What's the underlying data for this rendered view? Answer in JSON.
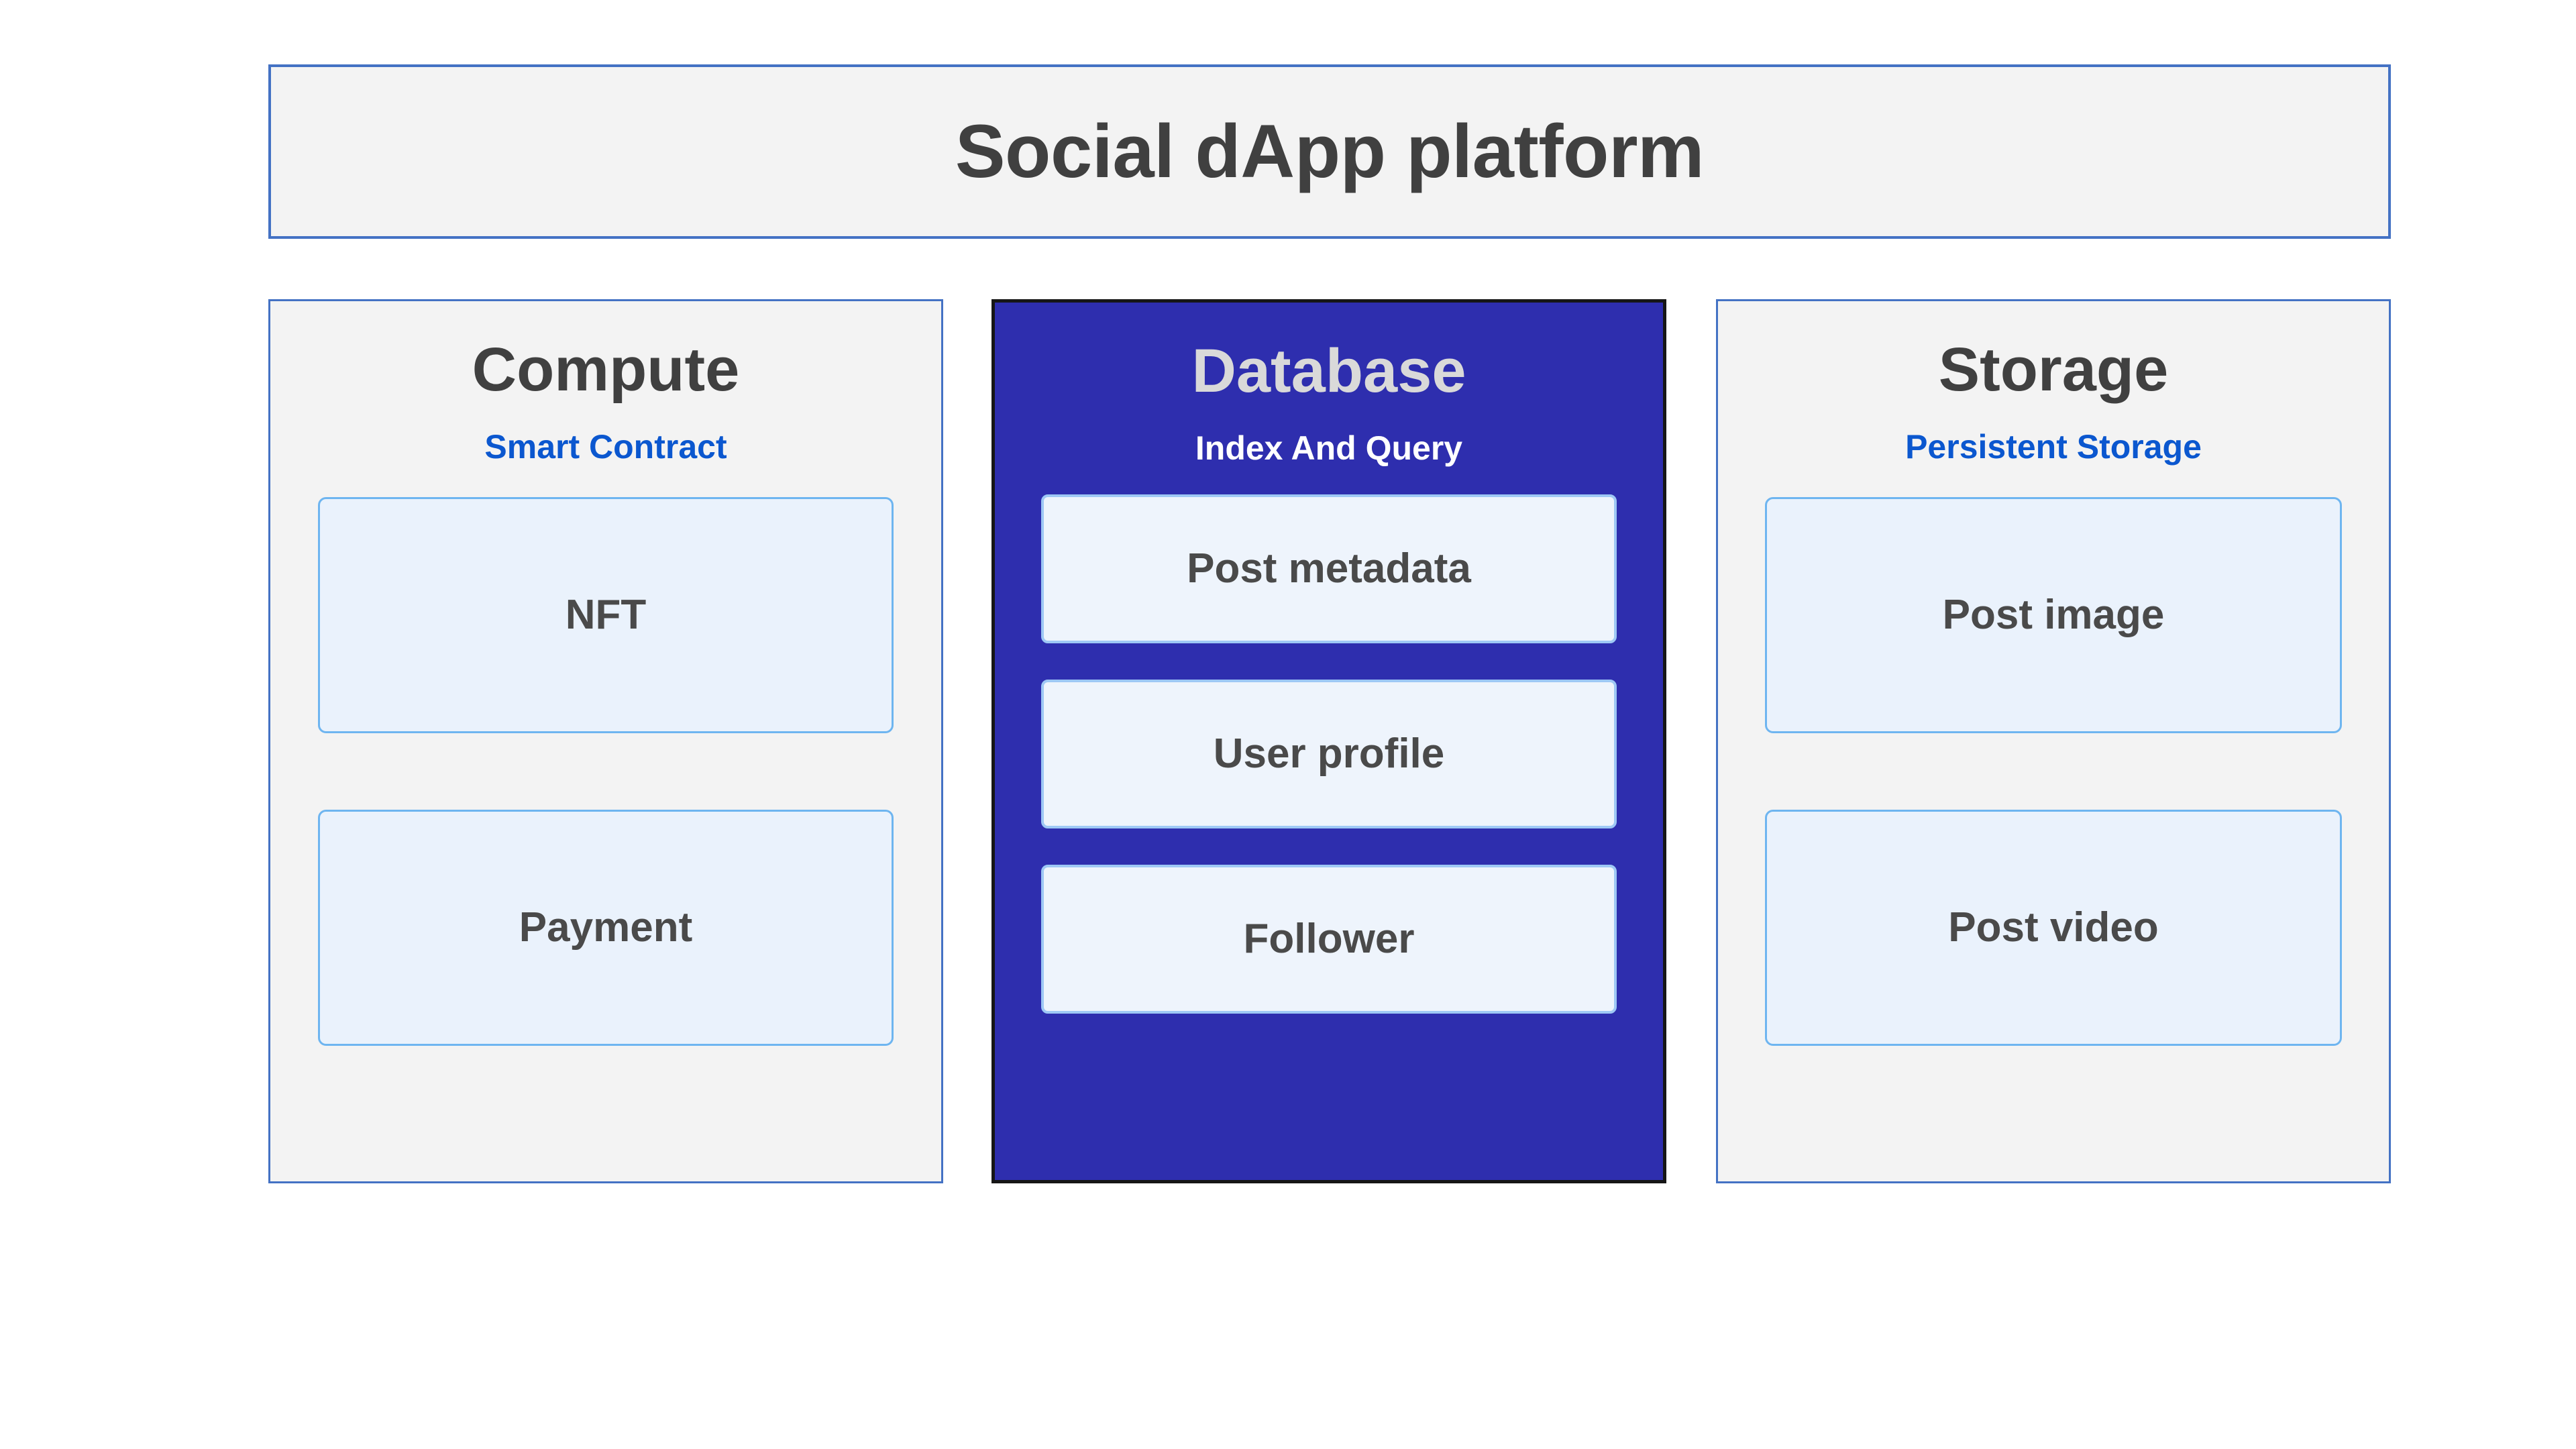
{
  "banner": {
    "title": "Social dApp platform"
  },
  "colors": {
    "banner_fill": "#f3f3f3",
    "banner_border": "#4472c4",
    "column_fill": "#f3f3f3",
    "column_border": "#4472c4",
    "highlight_fill": "#2e2eae",
    "highlight_border": "#161616",
    "card_fill": "#eaf2fc",
    "card_border": "#6eb5f0",
    "title_text": "#404040",
    "subtitle_text": "#0b57cf",
    "highlight_title_text": "#d9d9d9",
    "highlight_subtitle_text": "#ffffff",
    "card_text": "#4a4a4a"
  },
  "columns": [
    {
      "id": "compute",
      "title": "Compute",
      "subtitle": "Smart Contract",
      "highlighted": false,
      "cards": [
        {
          "label": "NFT"
        },
        {
          "label": "Payment"
        }
      ]
    },
    {
      "id": "database",
      "title": "Database",
      "subtitle": "Index And Query",
      "highlighted": true,
      "cards": [
        {
          "label": "Post metadata"
        },
        {
          "label": "User  profile"
        },
        {
          "label": "Follower"
        }
      ]
    },
    {
      "id": "storage",
      "title": "Storage",
      "subtitle": "Persistent Storage",
      "highlighted": false,
      "cards": [
        {
          "label": "Post image"
        },
        {
          "label": "Post video"
        }
      ]
    }
  ]
}
